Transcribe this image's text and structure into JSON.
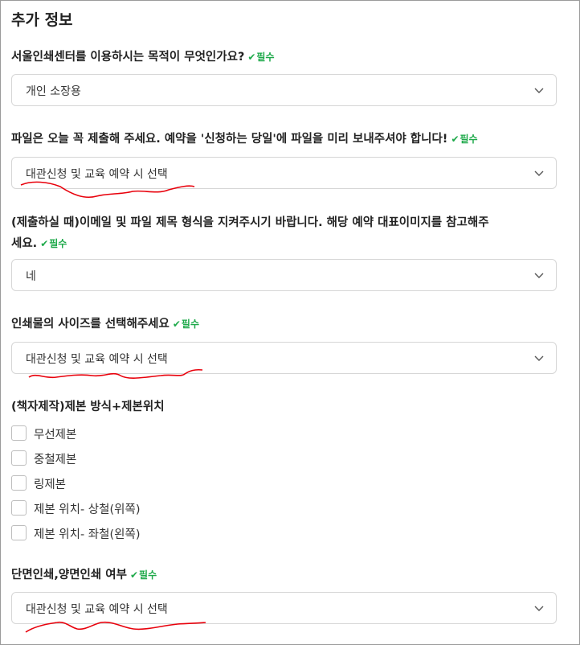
{
  "section_title": "추가 정보",
  "required_label": "필수",
  "q1": {
    "label": "서울인쇄센터를 이용하시는 목적이 무엇인가요?",
    "value": "개인 소장용"
  },
  "q2": {
    "label": "파일은 오늘 꼭 제출해 주세요. 예약을 '신청하는 당일'에 파일을 미리 보내주셔야 합니다!",
    "value": "대관신청 및 교육 예약 시 선택"
  },
  "q3": {
    "label_line1": "(제출하실 때)이메일 및 파일 제목 형식을 지켜주시기 바랍니다. 해당 예약 대표이미지를 참고해주",
    "label_line2": "세요.",
    "value": "네"
  },
  "q4": {
    "label": "인쇄물의 사이즈를 선택해주세요",
    "value": "대관신청 및 교육 예약 시 선택"
  },
  "q5": {
    "label": "(책자제작)제본 방식+제본위치",
    "options": [
      "무선제본",
      "중철제본",
      "링제본",
      "제본 위치- 상철(위쪽)",
      "제본 위치- 좌철(왼쪽)"
    ]
  },
  "q6": {
    "label": "단면인쇄,양면인쇄 여부",
    "value": "대관신청 및 교육 예약 시 선택"
  },
  "colors": {
    "required": "#1ea94a",
    "annotation": "#e8000b",
    "border": "#d6d6d6"
  }
}
